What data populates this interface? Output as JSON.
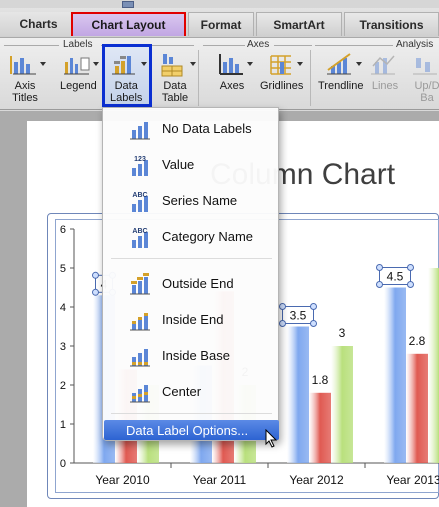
{
  "tabs": [
    {
      "label": "Charts"
    },
    {
      "label": "Chart Layout"
    },
    {
      "label": "Format"
    },
    {
      "label": "SmartArt"
    },
    {
      "label": "Transitions"
    }
  ],
  "ribbon": {
    "groups": {
      "labels": "Labels",
      "axes": "Axes",
      "analysis": "Analysis"
    },
    "buttons": {
      "axis_titles": [
        "Axis",
        "Titles"
      ],
      "legend": "Legend",
      "data_labels": [
        "Data",
        "Labels"
      ],
      "data_table": [
        "Data",
        "Table"
      ],
      "axes": "Axes",
      "gridlines": "Gridlines",
      "trendline": "Trendline",
      "lines": "Lines",
      "updown_bars": [
        "Up/D",
        "Ba"
      ]
    }
  },
  "menu": {
    "items": [
      {
        "label": "No Data Labels",
        "icon": "no-data-labels-icon"
      },
      {
        "label": "Value",
        "icon": "value-icon",
        "badge": "123"
      },
      {
        "label": "Series Name",
        "icon": "series-name-icon",
        "badge": "ABC"
      },
      {
        "label": "Category Name",
        "icon": "category-name-icon",
        "badge": "ABC"
      },
      {
        "label": "Outside End",
        "icon": "outside-end-icon"
      },
      {
        "label": "Inside End",
        "icon": "inside-end-icon"
      },
      {
        "label": "Inside Base",
        "icon": "inside-base-icon"
      },
      {
        "label": "Center",
        "icon": "center-icon"
      }
    ],
    "options_label": "Data Label Options..."
  },
  "chart_data": {
    "type": "bar",
    "title": "Column Chart",
    "categories": [
      "Year 2010",
      "Year 2011",
      "Year 2012",
      "Year 2013"
    ],
    "series": [
      {
        "values": [
          4.3,
          2.5,
          3.5,
          4.5
        ],
        "labels": [
          "4",
          "",
          "3.5",
          "4.5"
        ],
        "color": "#7fa8ef"
      },
      {
        "values": [
          2.4,
          4.4,
          1.8,
          2.8
        ],
        "labels": [
          "",
          "",
          "1.8",
          "2.8"
        ],
        "color": "#e05a52"
      },
      {
        "values": [
          2.0,
          2.0,
          3.0,
          5.0
        ],
        "labels": [
          "",
          "2",
          "3",
          ""
        ],
        "color": "#b9e07d"
      }
    ],
    "ylim": [
      0,
      6
    ],
    "yticks": [
      0,
      1,
      2,
      3,
      4,
      5,
      6
    ],
    "grid": false,
    "legend": "none"
  },
  "colors": {
    "selected_tab_border": "#e00000",
    "data_labels_highlight": "#0b2fd1",
    "menu_highlight": "#2d63d2"
  }
}
